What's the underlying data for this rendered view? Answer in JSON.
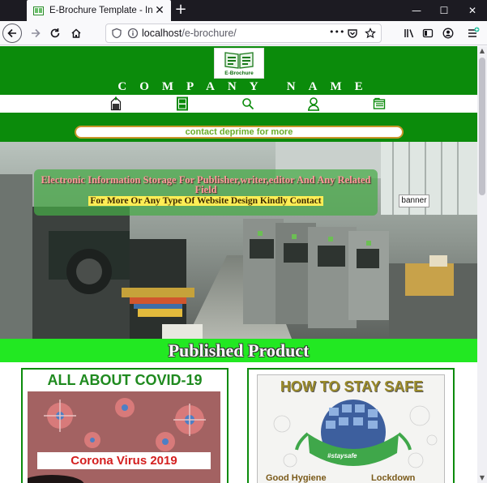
{
  "browser": {
    "tab_title": "E-Brochure Template - Index",
    "url_host": "localhost",
    "url_path": "/e-brochure/",
    "url_more": "•••"
  },
  "page": {
    "logo_caption": "E-Brochure",
    "company_name": "COMPANY NAME",
    "nav_icons": [
      "home-icon",
      "app-icon",
      "search-icon",
      "user-icon",
      "list-icon"
    ],
    "contact_text": "contact deprime for more",
    "banner_line1": "Electronic Information Storage For Publisher,writer,editor And Any Related Field",
    "banner_line2": "For More Or Any Type Of Website Design Kindly Contact",
    "banner_tag": "banner",
    "section_title": "Published Product",
    "card1_title": "ALL ABOUT COVID-19",
    "card1_caption": "Corona Virus 2019",
    "card2_title": "HOW TO STAY SAFE",
    "card2_badge": "#staysafe",
    "card2_left": "Good Hygiene",
    "card2_right": "Lockdown"
  },
  "colors": {
    "brand_green": "#0b8b0b",
    "bright_green": "#22e822",
    "contact_text": "#6aad2a"
  }
}
